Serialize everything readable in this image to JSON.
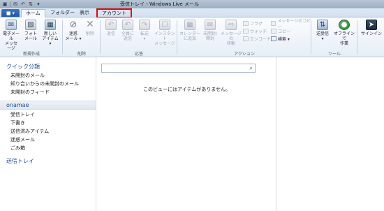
{
  "window": {
    "title": "受信トレイ - Windows Live メール"
  },
  "tabs": [
    {
      "label": "ホーム"
    },
    {
      "label": "フォルダー"
    },
    {
      "label": "表示"
    },
    {
      "label": "アカウント"
    }
  ],
  "menu_button": {
    "label": "▾"
  },
  "ribbon": {
    "new_group": {
      "label": "新規作成",
      "email_label": "電子メール\nメッセージ",
      "photo_label": "フォト\nメール",
      "new_item_label": "新しい\nアイテム ▾"
    },
    "delete_group": {
      "label": "削除",
      "junk_label": "迷惑\nメール ▾",
      "delete_label": "削除"
    },
    "respond_group": {
      "label": "応答",
      "reply_label": "返信",
      "reply_all_label": "全員に\n返信",
      "forward_label": "転送\n▾",
      "im_label": "インスタント\nメッセージ"
    },
    "actions_group": {
      "label": "アクション",
      "add_calendar_label": "カレンダー\nに追加",
      "unread_label": "未開封/\n開封",
      "move_label": "メッセージの\n移動",
      "flag_label": "フラグ",
      "watch_label": "ウォッチ",
      "encode_label": "エンコード",
      "copy_msg_label": "メッセージのコピー",
      "copy_label": "コピー",
      "find_label": "検索 ▾"
    },
    "tools_group": {
      "label": "ツール",
      "send_recv_label": "送受信\n▾",
      "offline_label": "オフラインで\n作業",
      "signin_label": "サインイン"
    }
  },
  "left_pane": {
    "quick_views_title": "クイック分類",
    "quick_views": [
      "未開封のメール",
      "知り合いからの未開封のメール",
      "未開封のフィード"
    ],
    "account_name": "onamae",
    "folders": [
      "受信トレイ",
      "下書き",
      "送信済みアイテム",
      "迷惑メール",
      "ごみ箱"
    ],
    "outbox": "送信トレイ"
  },
  "list_pane": {
    "search_placeholder": "",
    "empty_message": "このビューにはアイテムがありません。"
  },
  "colors": {
    "accent": "#1c4e93",
    "highlight_border": "#e00000"
  }
}
